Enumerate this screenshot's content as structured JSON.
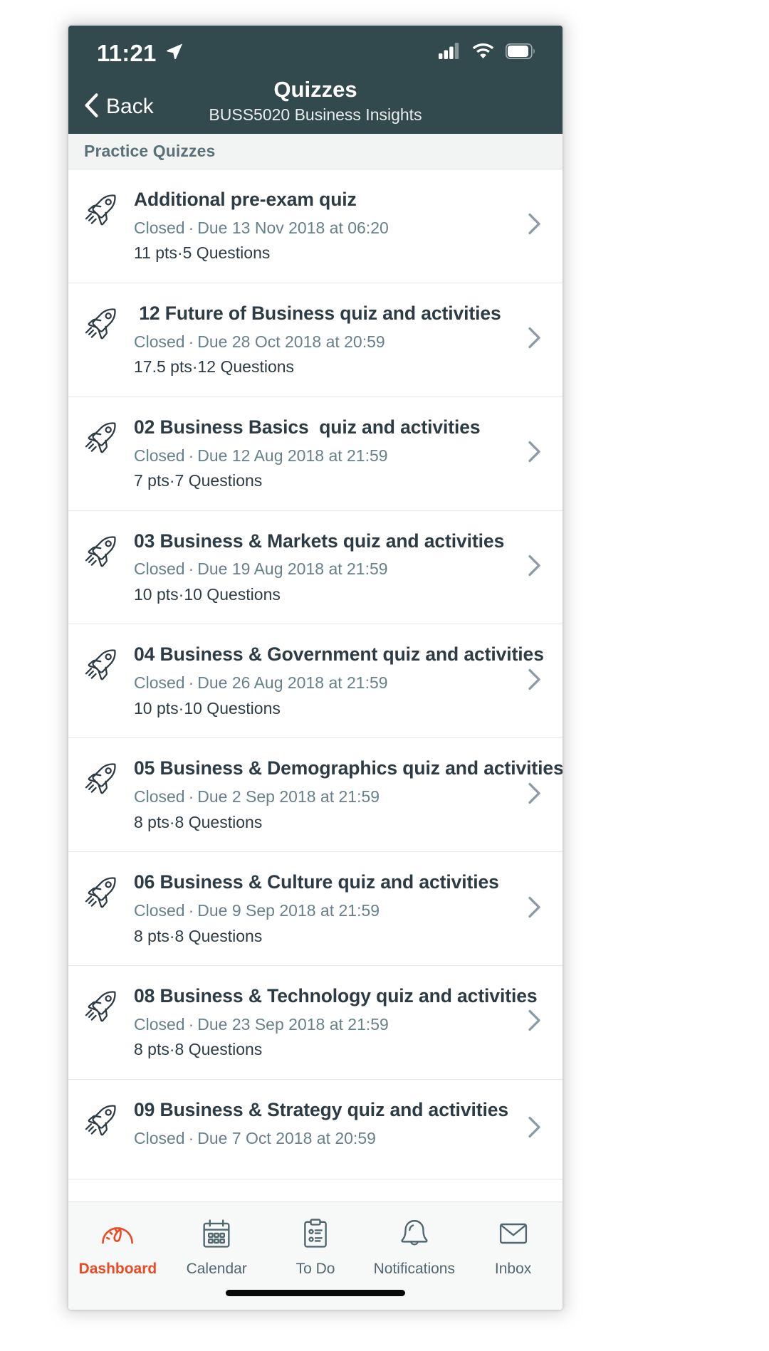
{
  "status_bar": {
    "time": "11:21",
    "location_icon": "location-arrow-icon",
    "signal_icon": "cellular-signal-icon",
    "wifi_icon": "wifi-icon",
    "battery_icon": "battery-icon"
  },
  "nav": {
    "back_label": "Back",
    "back_icon": "chevron-left-icon",
    "title": "Quizzes",
    "subtitle": "BUSS5020 Business Insights"
  },
  "section": {
    "header": "Practice Quizzes"
  },
  "colors": {
    "header_bg": "#324a4d",
    "accent": "#ee4925",
    "title_text": "#2d3b45",
    "meta_text": "#68808a",
    "section_bg": "#f2f3f3",
    "tabbar_bg": "#f7f8f8"
  },
  "quizzes": [
    {
      "icon": "rocket-icon",
      "title": "Additional pre-exam quiz",
      "status": "Closed",
      "due": "Due 13 Nov 2018 at 06:20",
      "points": "11 pts",
      "questions": "5 Questions",
      "chevron": "chevron-right-icon"
    },
    {
      "icon": "rocket-icon",
      "title": " 12 Future of Business quiz and activities",
      "status": "Closed",
      "due": "Due 28 Oct 2018 at 20:59",
      "points": "17.5 pts",
      "questions": "12 Questions",
      "chevron": "chevron-right-icon"
    },
    {
      "icon": "rocket-icon",
      "title": "02 Business Basics  quiz and activities",
      "status": "Closed",
      "due": "Due 12 Aug 2018 at 21:59",
      "points": "7 pts",
      "questions": "7 Questions",
      "chevron": "chevron-right-icon"
    },
    {
      "icon": "rocket-icon",
      "title": "03 Business & Markets quiz and activities",
      "status": "Closed",
      "due": "Due 19 Aug 2018 at 21:59",
      "points": "10 pts",
      "questions": "10 Questions",
      "chevron": "chevron-right-icon"
    },
    {
      "icon": "rocket-icon",
      "title": "04 Business & Government quiz and activities",
      "status": "Closed",
      "due": "Due 26 Aug 2018 at 21:59",
      "points": "10 pts",
      "questions": "10 Questions",
      "chevron": "chevron-right-icon"
    },
    {
      "icon": "rocket-icon",
      "title": "05 Business & Demographics quiz and activities",
      "status": "Closed",
      "due": "Due 2 Sep 2018 at 21:59",
      "points": "8 pts",
      "questions": "8 Questions",
      "chevron": "chevron-right-icon"
    },
    {
      "icon": "rocket-icon",
      "title": "06 Business & Culture quiz and activities",
      "status": "Closed",
      "due": "Due 9 Sep 2018 at 21:59",
      "points": "8 pts",
      "questions": "8 Questions",
      "chevron": "chevron-right-icon"
    },
    {
      "icon": "rocket-icon",
      "title": "08 Business & Technology quiz and activities",
      "status": "Closed",
      "due": "Due 23 Sep 2018 at 21:59",
      "points": "8 pts",
      "questions": "8 Questions",
      "chevron": "chevron-right-icon"
    },
    {
      "icon": "rocket-icon",
      "title": "09 Business & Strategy quiz and activities",
      "status": "Closed",
      "due": "Due 7 Oct 2018 at 20:59",
      "points": "",
      "questions": "",
      "chevron": "chevron-right-icon"
    }
  ],
  "tabs": [
    {
      "label": "Dashboard",
      "icon": "speedometer-icon",
      "active": true
    },
    {
      "label": "Calendar",
      "icon": "calendar-icon",
      "active": false
    },
    {
      "label": "To Do",
      "icon": "clipboard-icon",
      "active": false
    },
    {
      "label": "Notifications",
      "icon": "bell-icon",
      "active": false
    },
    {
      "label": "Inbox",
      "icon": "envelope-icon",
      "active": false
    }
  ]
}
